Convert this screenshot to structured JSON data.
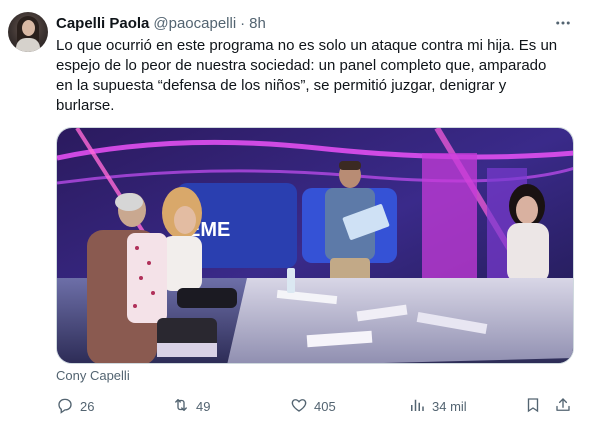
{
  "tweet": {
    "author_name": "Capelli Paola",
    "handle": "@paocapelli",
    "separator": "·",
    "time": "8h",
    "text_lines": [
      "Lo que ocurrió en este programa no es solo un ataque contra mi hija. Es un",
      "espejo de lo peor de nuestra sociedad: un panel completo que, amparado",
      "en la supuesta “defensa de los niños”, se permitió juzgar, denigrar y",
      "burlarse."
    ],
    "media_credit": "Cony Capelli",
    "media_sign_text": "EME"
  },
  "actions": {
    "replies": "26",
    "reposts": "49",
    "likes": "405",
    "views": "34 mil"
  },
  "icons": {
    "more": "more-dots-icon",
    "reply": "reply-bubble-icon",
    "repost": "repost-arrows-icon",
    "like": "heart-icon",
    "views": "bar-chart-icon",
    "bookmark": "bookmark-icon",
    "share": "share-upload-icon"
  },
  "colors": {
    "text_primary": "#0f1419",
    "text_secondary": "#536471",
    "studio_magenta": "#c63bd8",
    "studio_blue": "#2a3fb0"
  }
}
